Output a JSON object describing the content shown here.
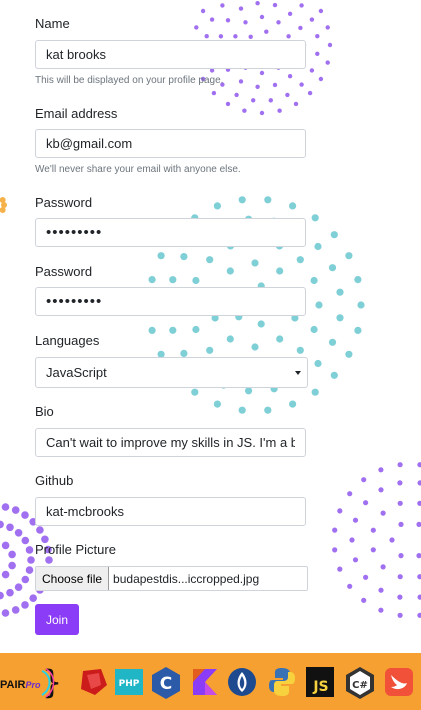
{
  "form": {
    "name": {
      "label": "Name",
      "value": "kat brooks",
      "help": "This will be displayed on your profile page."
    },
    "email": {
      "label": "Email address",
      "value": "kb@gmail.com",
      "help": "We'll never share your email with anyone else."
    },
    "password": {
      "label": "Password",
      "value": "•••••••••"
    },
    "password_confirm": {
      "label": "Password",
      "value": "•••••••••"
    },
    "languages": {
      "label": "Languages",
      "selected": "JavaScript"
    },
    "bio": {
      "label": "Bio",
      "value": "Can't wait to improve my skills in JS. I'm a be"
    },
    "github": {
      "label": "Github",
      "value": "kat-mcbrooks"
    },
    "picture": {
      "label": "Profile Picture",
      "button": "Choose file",
      "filename": "budapestdis...iccropped.jpg"
    },
    "submit_label": "Join"
  },
  "footer": {
    "logo_text": "PAIR",
    "logo_suffix": "Pro",
    "icons": [
      "ruby-icon",
      "php-icon",
      "c-icon",
      "kotlin-icon",
      "perl-icon",
      "python-icon",
      "javascript-icon",
      "csharp-icon",
      "swift-icon"
    ],
    "php_text": "PHP",
    "c_text": "C",
    "js_text": "JS",
    "csharp_text": "C#"
  },
  "colors": {
    "accent": "#8b3cf6",
    "dots_purple": "#a070f0",
    "dots_teal": "#7fcfd6",
    "dots_orange": "#f5b24a",
    "footer_bg": "#f5a030"
  }
}
